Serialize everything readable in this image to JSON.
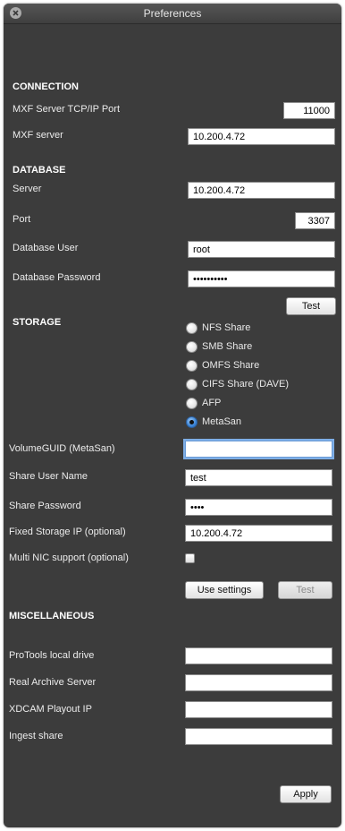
{
  "window": {
    "title": "Preferences"
  },
  "connection": {
    "header": "CONNECTION",
    "port_label": "MXF Server TCP/IP Port",
    "port_value": "11000",
    "server_label": "MXF server",
    "server_value": "10.200.4.72"
  },
  "database": {
    "header": "DATABASE",
    "server_label": "Server",
    "server_value": "10.200.4.72",
    "port_label": "Port",
    "port_value": "3307",
    "user_label": "Database User",
    "user_value": "root",
    "password_label": "Database Password",
    "password_value": "••••••••••",
    "test_label": "Test"
  },
  "storage": {
    "header": "STORAGE",
    "options": [
      {
        "label": "NFS Share",
        "selected": false
      },
      {
        "label": "SMB Share",
        "selected": false
      },
      {
        "label": "OMFS Share",
        "selected": false
      },
      {
        "label": "CIFS Share (DAVE)",
        "selected": false
      },
      {
        "label": "AFP",
        "selected": false
      },
      {
        "label": "MetaSan",
        "selected": true
      }
    ],
    "volume_guid_label": "VolumeGUID (MetaSan)",
    "volume_guid_value": "",
    "share_user_label": "Share User Name",
    "share_user_value": "test",
    "share_password_label": "Share Password",
    "share_password_value": "••••",
    "fixed_ip_label": "Fixed Storage IP (optional)",
    "fixed_ip_value": "10.200.4.72",
    "multi_nic_label": "Multi NIC support (optional)",
    "multi_nic_checked": false,
    "use_settings_label": "Use settings",
    "test_label": "Test"
  },
  "misc": {
    "header": "MISCELLANEOUS",
    "protools_label": "ProTools local drive",
    "protools_value": "",
    "archive_label": "Real Archive Server",
    "archive_value": "",
    "xdcam_label": "XDCAM Playout IP",
    "xdcam_value": "",
    "ingest_label": "Ingest share",
    "ingest_value": ""
  },
  "apply_label": "Apply"
}
